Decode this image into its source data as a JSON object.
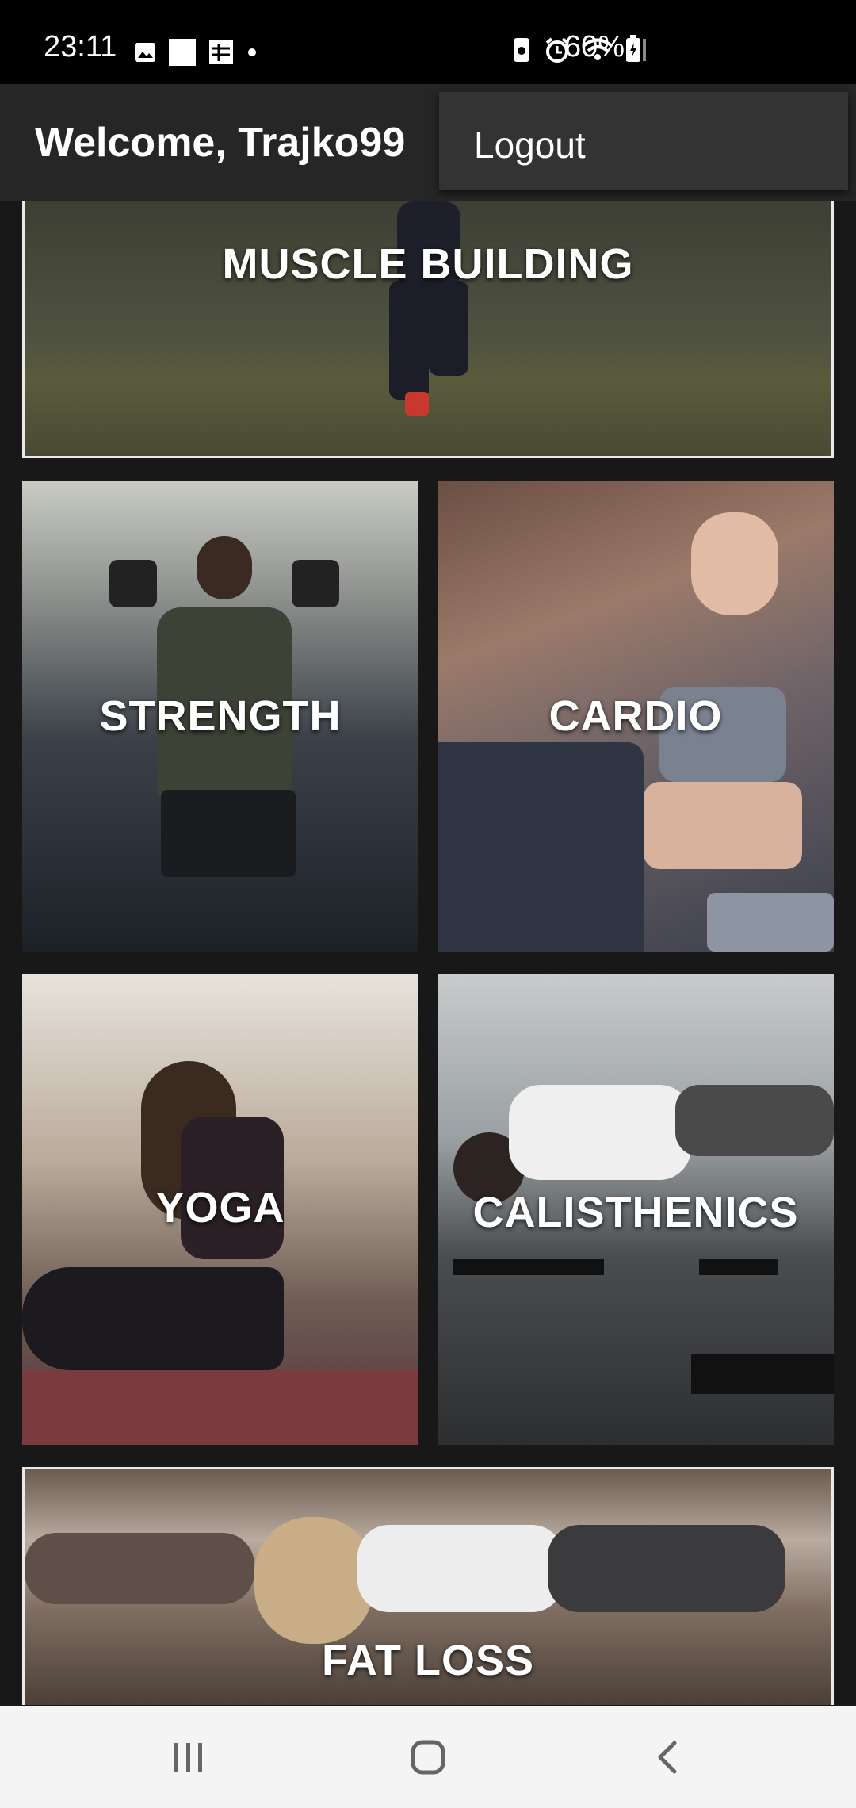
{
  "status_bar": {
    "time": "23:11",
    "battery_percent": "60%",
    "left_icons": [
      "image-icon",
      "square-icon",
      "photos-icon",
      "dot-icon"
    ],
    "right_icons": [
      "vibrate-icon",
      "alarm-icon",
      "wifi-icon",
      "signal-icon",
      "battery-icon"
    ]
  },
  "header": {
    "welcome_text": "Welcome, Trajko99",
    "logout_label": "Logout"
  },
  "categories": [
    {
      "label": "MUSCLE BUILDING"
    },
    {
      "label": "STRENGTH"
    },
    {
      "label": "CARDIO"
    },
    {
      "label": "YOGA"
    },
    {
      "label": "CALISTHENICS"
    },
    {
      "label": "FAT LOSS"
    }
  ],
  "nav_bar": {
    "items": [
      "recents-icon",
      "home-icon",
      "back-icon"
    ]
  },
  "colors": {
    "background": "#181818",
    "header": "#262626",
    "menu": "#333333",
    "tile_border": "#e9e9e9",
    "nav_bar": "#f4f4f4"
  }
}
